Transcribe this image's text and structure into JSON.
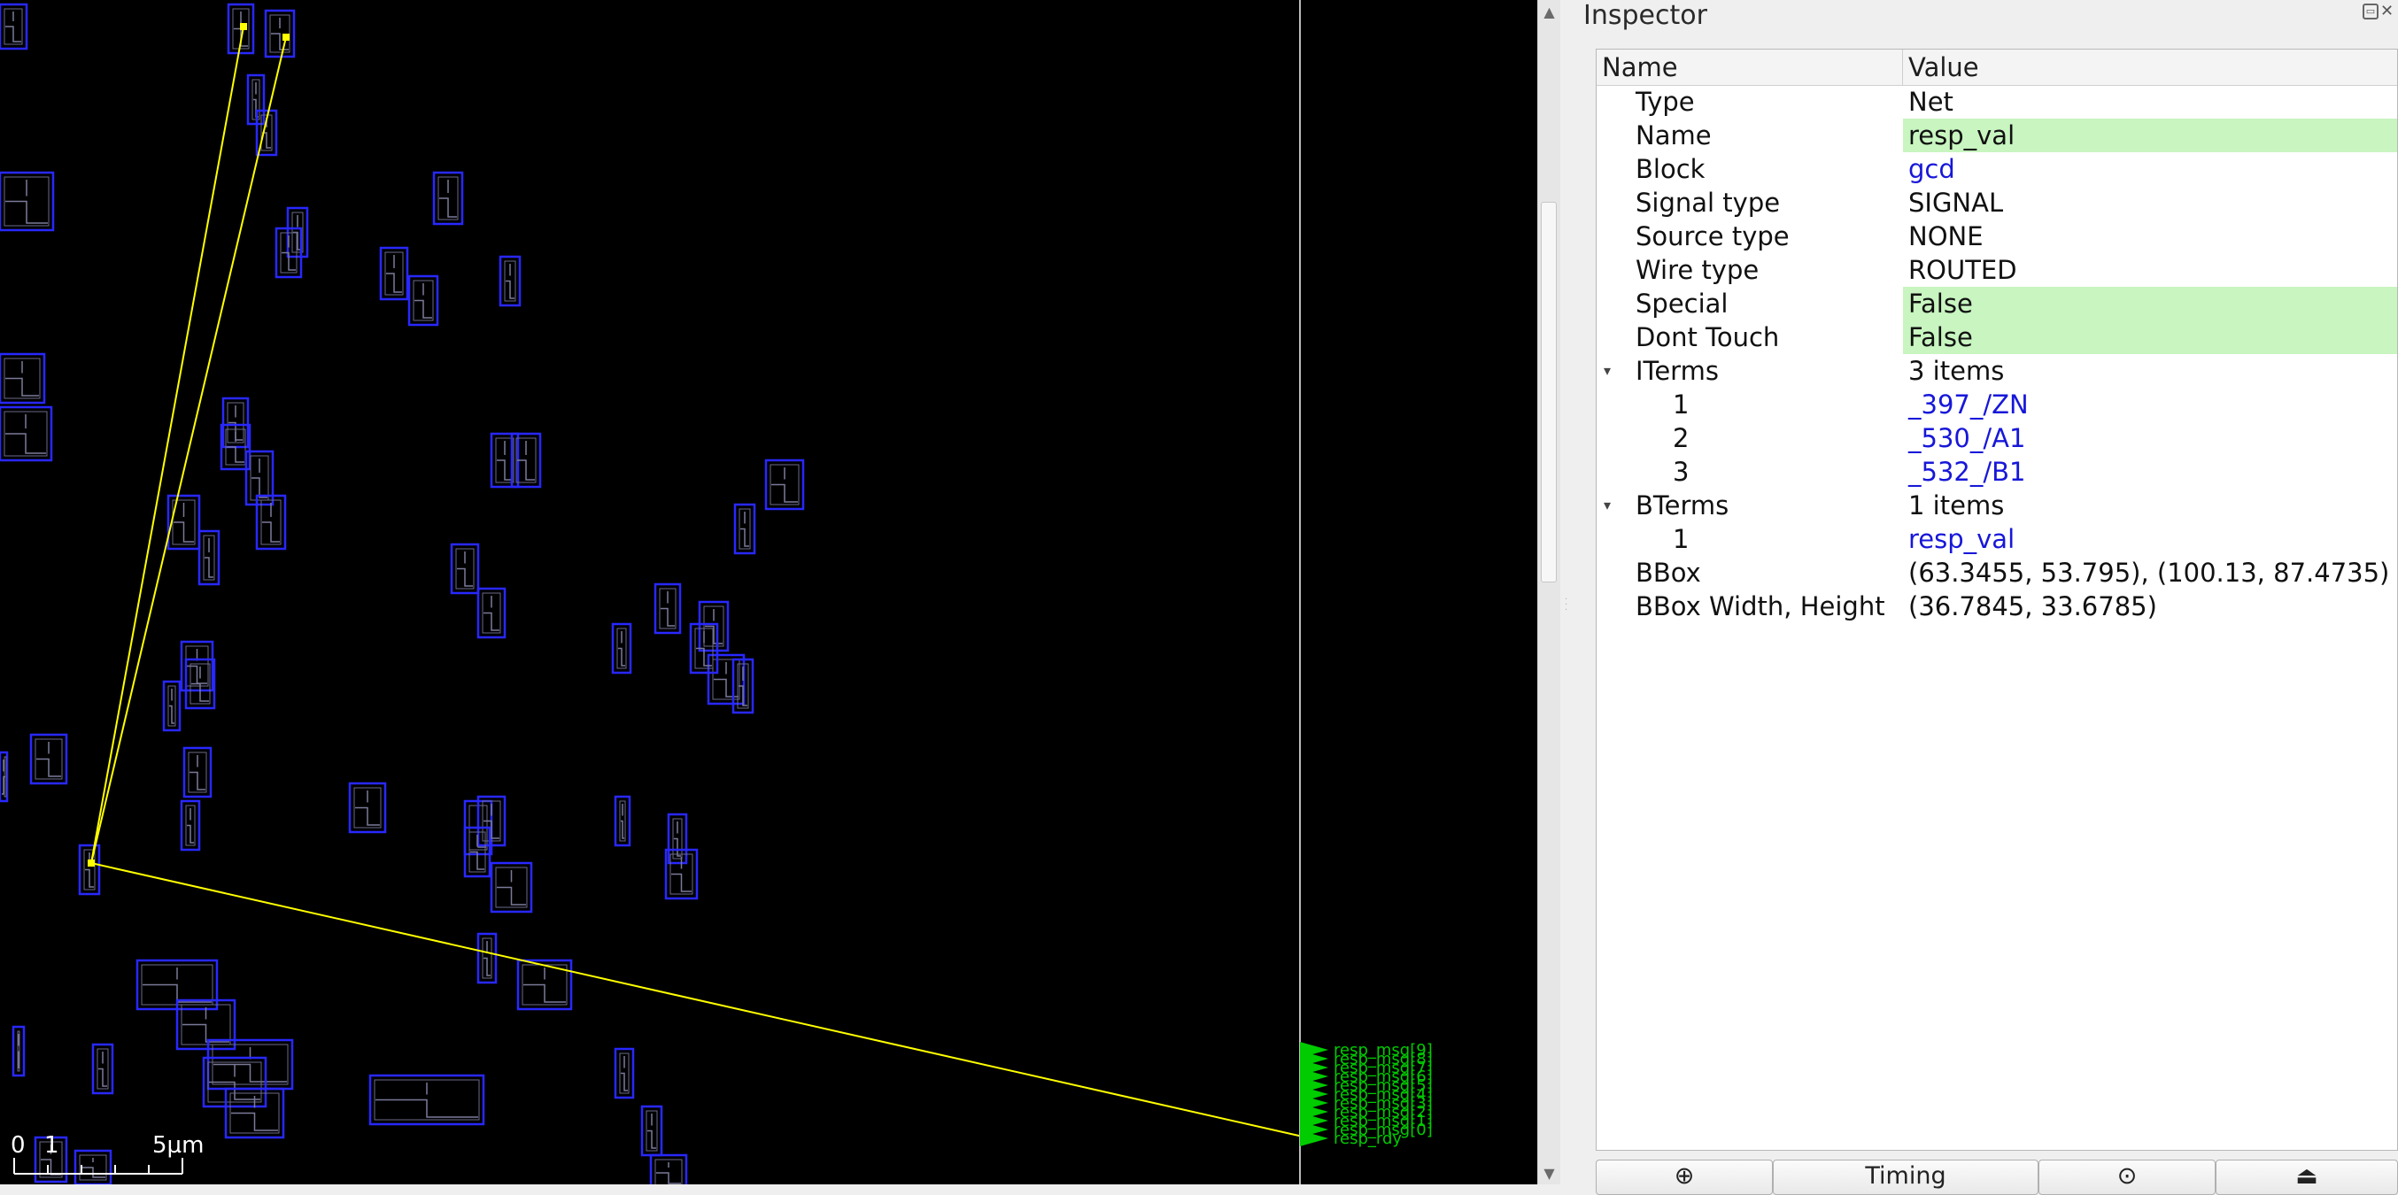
{
  "scale_bar": {
    "tick_0": "0",
    "tick_1": "1",
    "tick_5": "5µm"
  },
  "pin_labels": [
    "resp_msg[9]",
    "resp_msg[8]",
    "resp_msg[7]",
    "resp_msg[6]",
    "resp_msg[5]",
    "resp_msg[4]",
    "resp_msg[3]",
    "resp_msg[2]",
    "resp_msg[1]",
    "resp_msg[0]",
    "resp_rdy"
  ],
  "colors": {
    "cell_outline": "#2828ff",
    "flightline": "#ffff00",
    "pin": "#00cc00",
    "highlight": "#c8f5c0",
    "link": "#1717d9"
  },
  "inspector": {
    "title": "Inspector",
    "col_name": "Name",
    "col_value": "Value",
    "rows": [
      {
        "name": "Type",
        "value": "Net"
      },
      {
        "name": "Name",
        "value": "resp_val"
      },
      {
        "name": "Block",
        "value": "gcd"
      },
      {
        "name": "Signal type",
        "value": "SIGNAL"
      },
      {
        "name": "Source type",
        "value": "NONE"
      },
      {
        "name": "Wire type",
        "value": "ROUTED"
      },
      {
        "name": "Special",
        "value": "False"
      },
      {
        "name": "Dont Touch",
        "value": "False"
      },
      {
        "name": "ITerms",
        "value": "3 items"
      },
      {
        "name": "1",
        "value": "_397_/ZN"
      },
      {
        "name": "2",
        "value": "_530_/A1"
      },
      {
        "name": "3",
        "value": "_532_/B1"
      },
      {
        "name": "BTerms",
        "value": "1 items"
      },
      {
        "name": "1",
        "value": "resp_val"
      },
      {
        "name": "BBox",
        "value": "(63.3455, 53.795), (100.13, 87.4735)"
      },
      {
        "name": "BBox Width, Height",
        "value": "(36.7845, 33.6785)"
      }
    ],
    "buttons": [
      "⊕",
      "Timing",
      "⊙",
      "⏏"
    ]
  }
}
